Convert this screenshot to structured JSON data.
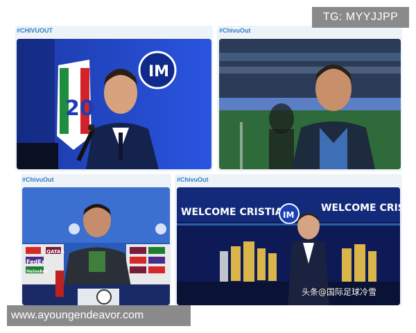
{
  "watermarks": {
    "top_right": "TG: MYYJJPP",
    "bottom_left": "www.ayoungendeavor.com",
    "source_credit": "头条@国际足球冷雪"
  },
  "panels": [
    {
      "hashtag": "#CHIVUOUT"
    },
    {
      "hashtag": "#ChivuOut"
    },
    {
      "hashtag": "#ChivuOut"
    },
    {
      "hashtag": "#ChivuOut"
    }
  ],
  "photo_text": {
    "scudetto_number": "20",
    "welcome_left": "WELCOME CRISTIAN",
    "welcome_right": "WELCOME CRISTIAN",
    "sponsors": [
      "FedEx",
      "Heineken",
      "QATAR"
    ]
  },
  "colors": {
    "hashtag": "#2f7fc6",
    "inter_blue": "#1a3fb4",
    "watermark_bg": "#8a8a8a"
  }
}
